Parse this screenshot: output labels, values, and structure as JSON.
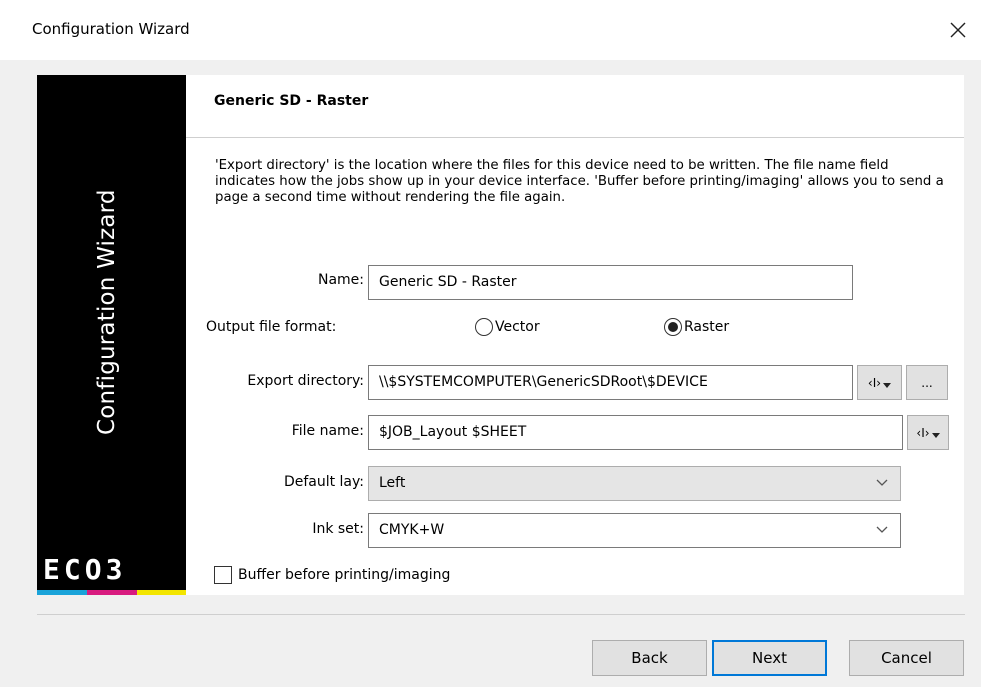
{
  "window": {
    "title": "Configuration Wizard",
    "close_glyph": "✕"
  },
  "sidebar": {
    "title": "Configuration Wizard",
    "logo_text": "ECO3",
    "strip_colors": [
      "#1aa3d9",
      "#d81b7f",
      "#f3e500"
    ]
  },
  "page": {
    "heading": "Generic SD - Raster",
    "description": "'Export directory' is the location where the files for this device need to be written. The file name field indicates how the jobs show up in your device interface. 'Buffer before printing/imaging' allows you to send a page a second time without rendering the file again."
  },
  "form": {
    "name_label": "Name:",
    "name_value": "Generic SD - Raster",
    "format_label": "Output file format:",
    "format_options": [
      "Vector",
      "Raster"
    ],
    "format_selected": "Raster",
    "export_label": "Export directory:",
    "export_value": "\\\\$SYSTEMCOMPUTER\\GenericSDRoot\\$DEVICE",
    "variable_button": "‹I›",
    "browse_button": "...",
    "filename_label": "File name:",
    "filename_value": "$JOB_Layout $SHEET",
    "lay_label": "Default lay:",
    "lay_value": "Left",
    "inkset_label": "Ink set:",
    "inkset_value": "CMYK+W",
    "buffer_label": "Buffer before printing/imaging",
    "buffer_checked": false
  },
  "buttons": {
    "back": "Back",
    "next": "Next",
    "cancel": "Cancel"
  }
}
